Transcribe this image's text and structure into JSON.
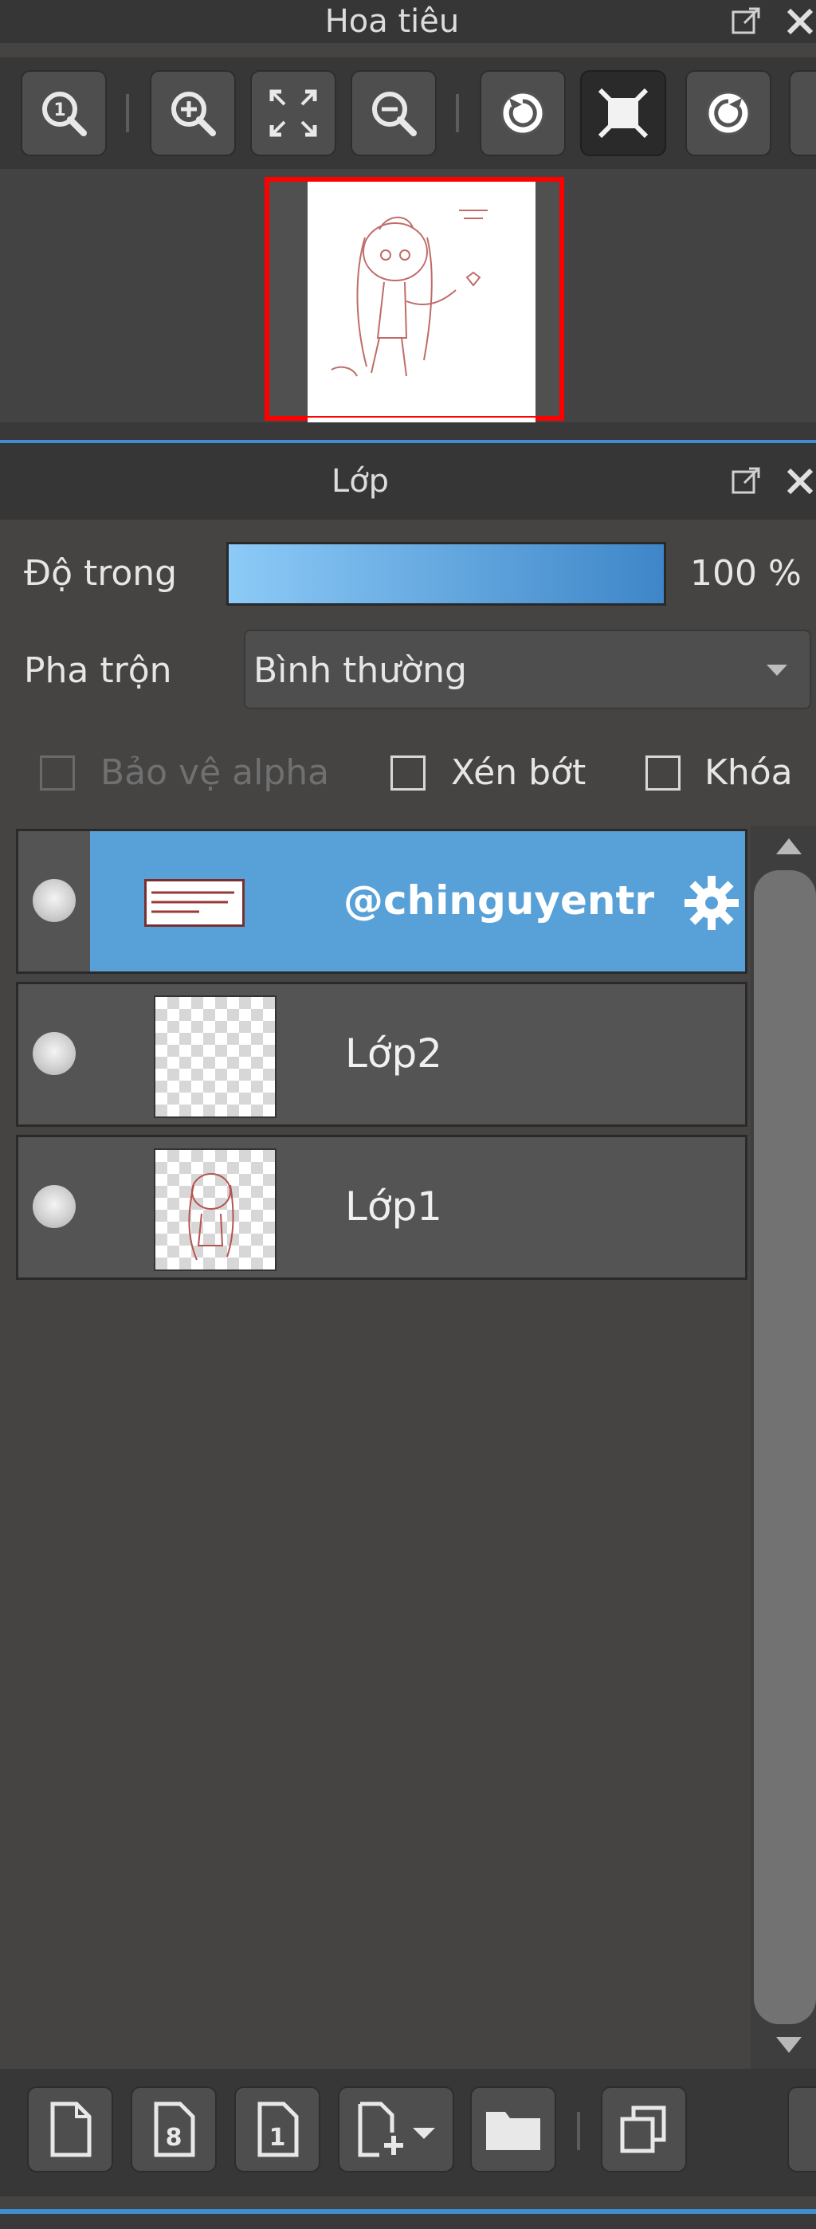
{
  "navigator": {
    "title": "Hoa tiêu",
    "toolbar": [
      {
        "icon": "zoom-actual-size-icon"
      },
      {
        "icon": "zoom-in-icon"
      },
      {
        "icon": "fit-to-window-icon"
      },
      {
        "icon": "zoom-out-icon"
      },
      {
        "icon": "rotate-left-icon"
      },
      {
        "icon": "reset-view-icon"
      },
      {
        "icon": "rotate-right-icon"
      }
    ],
    "preview_icon": "canvas-thumbnail"
  },
  "layers": {
    "title": "Lớp",
    "opacity_label": "Độ trong",
    "opacity_value": "100 %",
    "opacity_fraction": 1.0,
    "blend_label": "Pha trộn",
    "blend_value": "Bình thường",
    "protect_alpha_label": "Bảo vệ alpha",
    "clipping_label": "Xén bớt",
    "lock_label": "Khóa",
    "items": [
      {
        "name": "@chinguyentr",
        "selected": true,
        "visible": true
      },
      {
        "name": "Lớp2",
        "selected": false,
        "visible": true
      },
      {
        "name": "Lớp1",
        "selected": false,
        "visible": true
      }
    ],
    "bottom_buttons": [
      {
        "icon": "new-layer-icon"
      },
      {
        "icon": "new-8bit-layer-icon"
      },
      {
        "icon": "new-1bit-layer-icon"
      },
      {
        "icon": "add-layer-dropdown-icon"
      },
      {
        "icon": "new-folder-icon"
      },
      {
        "icon": "duplicate-layer-icon"
      }
    ]
  },
  "colors": {
    "accent": "#58a0d8",
    "panel_bg": "#454443",
    "title_bg": "#373636",
    "preview_frame": "#ff0000"
  }
}
